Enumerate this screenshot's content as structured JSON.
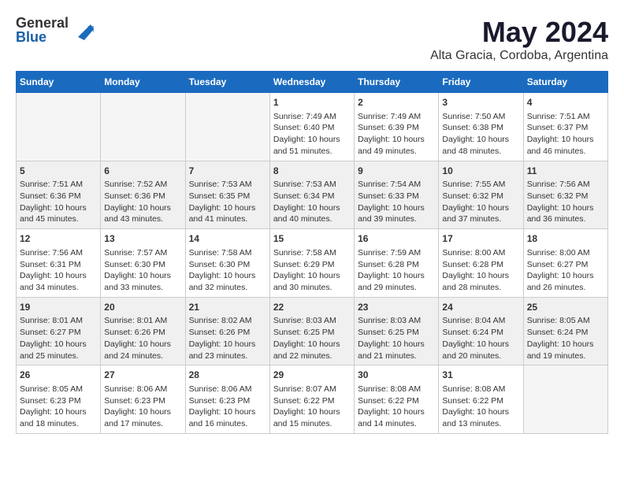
{
  "logo": {
    "general": "General",
    "blue": "Blue"
  },
  "title": "May 2024",
  "subtitle": "Alta Gracia, Cordoba, Argentina",
  "days_of_week": [
    "Sunday",
    "Monday",
    "Tuesday",
    "Wednesday",
    "Thursday",
    "Friday",
    "Saturday"
  ],
  "weeks": [
    {
      "row_class": "row-odd",
      "cells": [
        {
          "day": "",
          "empty": true
        },
        {
          "day": "",
          "empty": true
        },
        {
          "day": "",
          "empty": true
        },
        {
          "day": "1",
          "line1": "Sunrise: 7:49 AM",
          "line2": "Sunset: 6:40 PM",
          "line3": "Daylight: 10 hours",
          "line4": "and 51 minutes."
        },
        {
          "day": "2",
          "line1": "Sunrise: 7:49 AM",
          "line2": "Sunset: 6:39 PM",
          "line3": "Daylight: 10 hours",
          "line4": "and 49 minutes."
        },
        {
          "day": "3",
          "line1": "Sunrise: 7:50 AM",
          "line2": "Sunset: 6:38 PM",
          "line3": "Daylight: 10 hours",
          "line4": "and 48 minutes."
        },
        {
          "day": "4",
          "line1": "Sunrise: 7:51 AM",
          "line2": "Sunset: 6:37 PM",
          "line3": "Daylight: 10 hours",
          "line4": "and 46 minutes."
        }
      ]
    },
    {
      "row_class": "row-even",
      "cells": [
        {
          "day": "5",
          "line1": "Sunrise: 7:51 AM",
          "line2": "Sunset: 6:36 PM",
          "line3": "Daylight: 10 hours",
          "line4": "and 45 minutes."
        },
        {
          "day": "6",
          "line1": "Sunrise: 7:52 AM",
          "line2": "Sunset: 6:36 PM",
          "line3": "Daylight: 10 hours",
          "line4": "and 43 minutes."
        },
        {
          "day": "7",
          "line1": "Sunrise: 7:53 AM",
          "line2": "Sunset: 6:35 PM",
          "line3": "Daylight: 10 hours",
          "line4": "and 41 minutes."
        },
        {
          "day": "8",
          "line1": "Sunrise: 7:53 AM",
          "line2": "Sunset: 6:34 PM",
          "line3": "Daylight: 10 hours",
          "line4": "and 40 minutes."
        },
        {
          "day": "9",
          "line1": "Sunrise: 7:54 AM",
          "line2": "Sunset: 6:33 PM",
          "line3": "Daylight: 10 hours",
          "line4": "and 39 minutes."
        },
        {
          "day": "10",
          "line1": "Sunrise: 7:55 AM",
          "line2": "Sunset: 6:32 PM",
          "line3": "Daylight: 10 hours",
          "line4": "and 37 minutes."
        },
        {
          "day": "11",
          "line1": "Sunrise: 7:56 AM",
          "line2": "Sunset: 6:32 PM",
          "line3": "Daylight: 10 hours",
          "line4": "and 36 minutes."
        }
      ]
    },
    {
      "row_class": "row-odd",
      "cells": [
        {
          "day": "12",
          "line1": "Sunrise: 7:56 AM",
          "line2": "Sunset: 6:31 PM",
          "line3": "Daylight: 10 hours",
          "line4": "and 34 minutes."
        },
        {
          "day": "13",
          "line1": "Sunrise: 7:57 AM",
          "line2": "Sunset: 6:30 PM",
          "line3": "Daylight: 10 hours",
          "line4": "and 33 minutes."
        },
        {
          "day": "14",
          "line1": "Sunrise: 7:58 AM",
          "line2": "Sunset: 6:30 PM",
          "line3": "Daylight: 10 hours",
          "line4": "and 32 minutes."
        },
        {
          "day": "15",
          "line1": "Sunrise: 7:58 AM",
          "line2": "Sunset: 6:29 PM",
          "line3": "Daylight: 10 hours",
          "line4": "and 30 minutes."
        },
        {
          "day": "16",
          "line1": "Sunrise: 7:59 AM",
          "line2": "Sunset: 6:28 PM",
          "line3": "Daylight: 10 hours",
          "line4": "and 29 minutes."
        },
        {
          "day": "17",
          "line1": "Sunrise: 8:00 AM",
          "line2": "Sunset: 6:28 PM",
          "line3": "Daylight: 10 hours",
          "line4": "and 28 minutes."
        },
        {
          "day": "18",
          "line1": "Sunrise: 8:00 AM",
          "line2": "Sunset: 6:27 PM",
          "line3": "Daylight: 10 hours",
          "line4": "and 26 minutes."
        }
      ]
    },
    {
      "row_class": "row-even",
      "cells": [
        {
          "day": "19",
          "line1": "Sunrise: 8:01 AM",
          "line2": "Sunset: 6:27 PM",
          "line3": "Daylight: 10 hours",
          "line4": "and 25 minutes."
        },
        {
          "day": "20",
          "line1": "Sunrise: 8:01 AM",
          "line2": "Sunset: 6:26 PM",
          "line3": "Daylight: 10 hours",
          "line4": "and 24 minutes."
        },
        {
          "day": "21",
          "line1": "Sunrise: 8:02 AM",
          "line2": "Sunset: 6:26 PM",
          "line3": "Daylight: 10 hours",
          "line4": "and 23 minutes."
        },
        {
          "day": "22",
          "line1": "Sunrise: 8:03 AM",
          "line2": "Sunset: 6:25 PM",
          "line3": "Daylight: 10 hours",
          "line4": "and 22 minutes."
        },
        {
          "day": "23",
          "line1": "Sunrise: 8:03 AM",
          "line2": "Sunset: 6:25 PM",
          "line3": "Daylight: 10 hours",
          "line4": "and 21 minutes."
        },
        {
          "day": "24",
          "line1": "Sunrise: 8:04 AM",
          "line2": "Sunset: 6:24 PM",
          "line3": "Daylight: 10 hours",
          "line4": "and 20 minutes."
        },
        {
          "day": "25",
          "line1": "Sunrise: 8:05 AM",
          "line2": "Sunset: 6:24 PM",
          "line3": "Daylight: 10 hours",
          "line4": "and 19 minutes."
        }
      ]
    },
    {
      "row_class": "row-odd",
      "cells": [
        {
          "day": "26",
          "line1": "Sunrise: 8:05 AM",
          "line2": "Sunset: 6:23 PM",
          "line3": "Daylight: 10 hours",
          "line4": "and 18 minutes."
        },
        {
          "day": "27",
          "line1": "Sunrise: 8:06 AM",
          "line2": "Sunset: 6:23 PM",
          "line3": "Daylight: 10 hours",
          "line4": "and 17 minutes."
        },
        {
          "day": "28",
          "line1": "Sunrise: 8:06 AM",
          "line2": "Sunset: 6:23 PM",
          "line3": "Daylight: 10 hours",
          "line4": "and 16 minutes."
        },
        {
          "day": "29",
          "line1": "Sunrise: 8:07 AM",
          "line2": "Sunset: 6:22 PM",
          "line3": "Daylight: 10 hours",
          "line4": "and 15 minutes."
        },
        {
          "day": "30",
          "line1": "Sunrise: 8:08 AM",
          "line2": "Sunset: 6:22 PM",
          "line3": "Daylight: 10 hours",
          "line4": "and 14 minutes."
        },
        {
          "day": "31",
          "line1": "Sunrise: 8:08 AM",
          "line2": "Sunset: 6:22 PM",
          "line3": "Daylight: 10 hours",
          "line4": "and 13 minutes."
        },
        {
          "day": "",
          "empty": true
        }
      ]
    }
  ]
}
